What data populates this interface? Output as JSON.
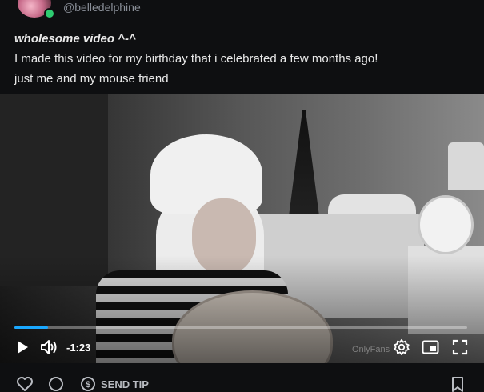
{
  "header": {
    "username": "@belledelphine"
  },
  "post": {
    "title": "wholesome video ^-^",
    "line1": "I made this video for my birthday that i celebrated a few months ago!",
    "line2": "just me and my mouse friend"
  },
  "video": {
    "time_remaining": "-1:23",
    "watermark": "OnlyFans",
    "progress_fraction": 0.075,
    "accent_color": "#1aa8ff"
  },
  "actions": {
    "send_tip_label": "SEND TIP"
  },
  "icons": {
    "avatar": "avatar-image",
    "online": "online-status-dot",
    "play": "play-icon",
    "volume": "volume-icon",
    "settings": "gear-icon",
    "pip": "picture-in-picture-icon",
    "fullscreen": "fullscreen-icon",
    "like": "heart-icon",
    "comment": "comment-icon",
    "tip": "dollar-circle-icon",
    "bookmark": "bookmark-icon"
  }
}
